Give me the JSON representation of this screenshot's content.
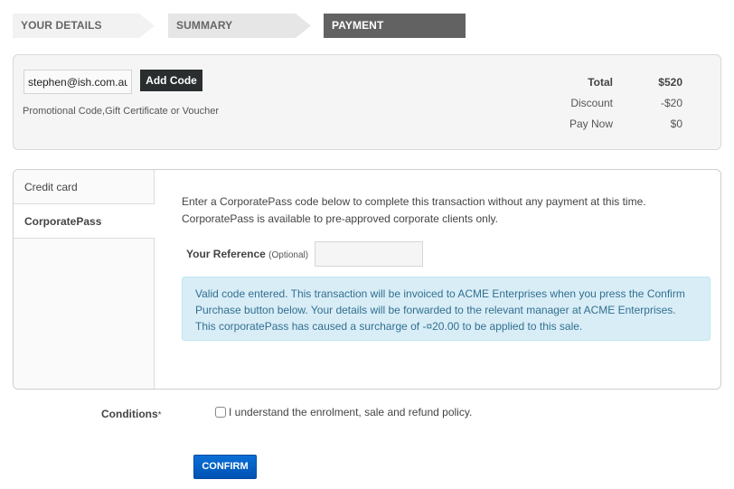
{
  "steps": [
    {
      "label": "YOUR DETAILS",
      "state": "done"
    },
    {
      "label": "SUMMARY",
      "state": "done"
    },
    {
      "label": "PAYMENT",
      "state": "active"
    }
  ],
  "promo": {
    "input_value": "stephen@ish.com.au",
    "add_code_label": "Add Code",
    "hint": "Promotional Code,Gift Certificate or Voucher"
  },
  "totals": [
    {
      "label": "Total",
      "value": "$520"
    },
    {
      "label": "Discount",
      "value": "-$20"
    },
    {
      "label": "Pay Now",
      "value": "$0"
    }
  ],
  "payment": {
    "tabs": [
      {
        "label": "Credit card",
        "active": false
      },
      {
        "label": "CorporatePass",
        "active": true
      }
    ],
    "intro": "Enter a CorporatePass code below to complete this transaction without any payment at this time. CorporatePass is available to pre-approved corporate clients only.",
    "reference_label": "Your Reference",
    "reference_optional": "(Optional)",
    "reference_value": "",
    "alert": "Valid code entered. This transaction will be invoiced to ACME Enterprises when you press the Confirm Purchase button below. Your details will be forwarded to the relevant manager at ACME Enterprises. This corporatePass has caused a surcharge of -¤20.00 to be applied to this sale."
  },
  "conditions": {
    "label": "Conditions",
    "required_mark": "*",
    "checkbox_text": "I understand the enrolment, sale and refund policy.",
    "checked": false
  },
  "confirm_label": "CONFIRM",
  "colors": {
    "active_step": "#626262",
    "confirm_button": "#0a6fd6",
    "alert_bg": "#d9edf7",
    "alert_text": "#31708f"
  }
}
